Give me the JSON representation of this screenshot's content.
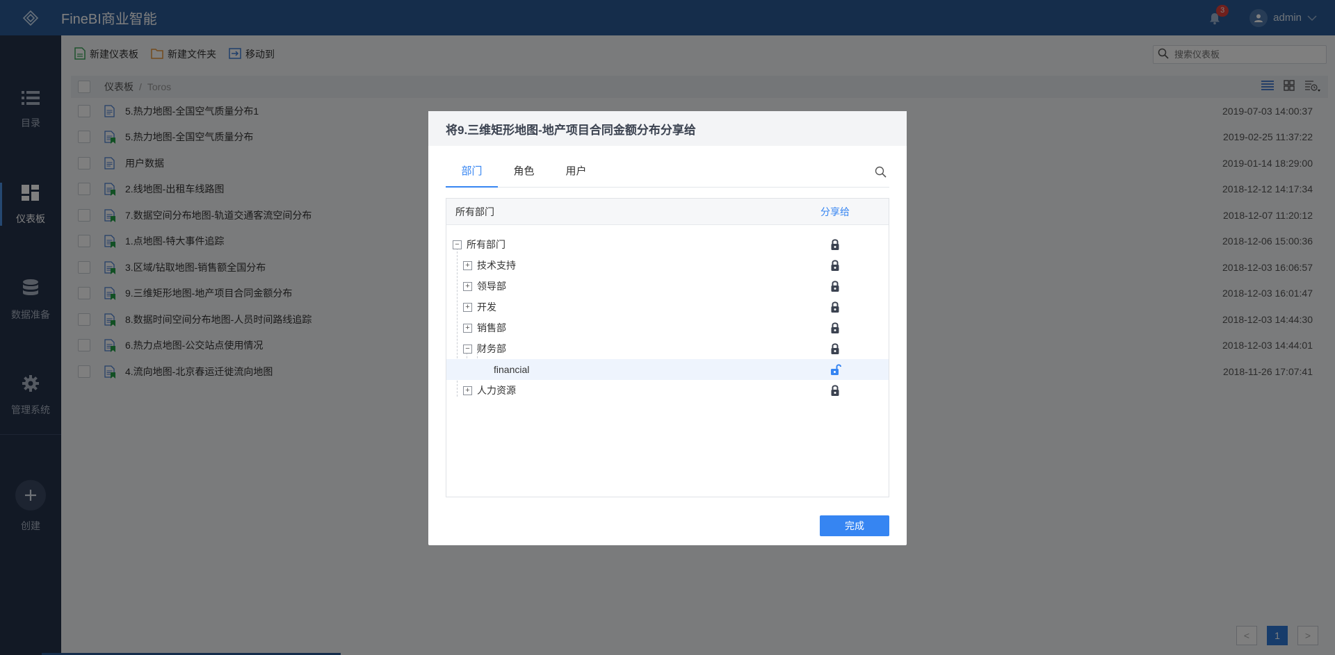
{
  "app": {
    "title": "FineBI商业智能"
  },
  "user": {
    "name": "admin",
    "notifications": "3"
  },
  "sidebar": {
    "items": [
      {
        "label": "目录",
        "icon": "list-icon"
      },
      {
        "label": "仪表板",
        "icon": "dashboard-icon",
        "active": true
      },
      {
        "label": "数据准备",
        "icon": "database-icon"
      },
      {
        "label": "管理系统",
        "icon": "gear-icon"
      }
    ],
    "create_label": "创建"
  },
  "toolbar": {
    "new_dashboard": "新建仪表板",
    "new_folder": "新建文件夹",
    "move_to": "移动到",
    "search_placeholder": "搜索仪表板"
  },
  "breadcrumb": {
    "root": "仪表板",
    "sep": "/",
    "current": "Toros"
  },
  "files": [
    {
      "name": "5.热力地图-全国空气质量分布1",
      "time": "2019-07-03 14:00:37",
      "shared": false
    },
    {
      "name": "5.热力地图-全国空气质量分布",
      "time": "2019-02-25 11:37:22",
      "shared": true
    },
    {
      "name": "用户数据",
      "time": "2019-01-14 18:29:00",
      "shared": false
    },
    {
      "name": "2.线地图-出租车线路图",
      "time": "2018-12-12 14:17:34",
      "shared": true
    },
    {
      "name": "7.数据空间分布地图-轨道交通客流空间分布",
      "time": "2018-12-07 11:20:12",
      "shared": true
    },
    {
      "name": "1.点地图-特大事件追踪",
      "time": "2018-12-06 15:00:36",
      "shared": true
    },
    {
      "name": "3.区域/钻取地图-销售额全国分布",
      "time": "2018-12-03 16:06:57",
      "shared": true
    },
    {
      "name": "9.三维矩形地图-地产项目合同金额分布",
      "time": "2018-12-03 16:01:47",
      "shared": true
    },
    {
      "name": "8.数据时间空间分布地图-人员时间路线追踪",
      "time": "2018-12-03 14:44:30",
      "shared": true
    },
    {
      "name": "6.热力点地图-公交站点使用情况",
      "time": "2018-12-03 14:44:01",
      "shared": true
    },
    {
      "name": "4.流向地图-北京春运迁徙流向地图",
      "time": "2018-11-26 17:07:41",
      "shared": true
    }
  ],
  "pagination": {
    "current": "1",
    "prev": "<",
    "next": ">"
  },
  "dialog": {
    "title": "将9.三维矩形地图-地产项目合同金额分布分享给",
    "tabs": [
      "部门",
      "角色",
      "用户"
    ],
    "active_tab": "部门",
    "tree_header": {
      "name": "所有部门",
      "share": "分享给"
    },
    "tree": [
      {
        "label": "所有部门",
        "level": 0,
        "state": "expanded",
        "locked": true
      },
      {
        "label": "技术支持",
        "level": 1,
        "state": "collapsed",
        "locked": true
      },
      {
        "label": "领导部",
        "level": 1,
        "state": "collapsed",
        "locked": true
      },
      {
        "label": "开发",
        "level": 1,
        "state": "collapsed",
        "locked": true
      },
      {
        "label": "销售部",
        "level": 1,
        "state": "collapsed",
        "locked": true
      },
      {
        "label": "财务部",
        "level": 1,
        "state": "expanded",
        "locked": true
      },
      {
        "label": "financial",
        "level": 2,
        "state": "leaf",
        "locked": false
      },
      {
        "label": "人力资源",
        "level": 1,
        "state": "collapsed",
        "locked": true
      }
    ],
    "done_label": "完成"
  },
  "colors": {
    "topbar": "#2a5a96",
    "sidebar": "#25324a",
    "accent": "#3685f2",
    "file_blue": "#4a7fd0",
    "share_green": "#24a148"
  }
}
